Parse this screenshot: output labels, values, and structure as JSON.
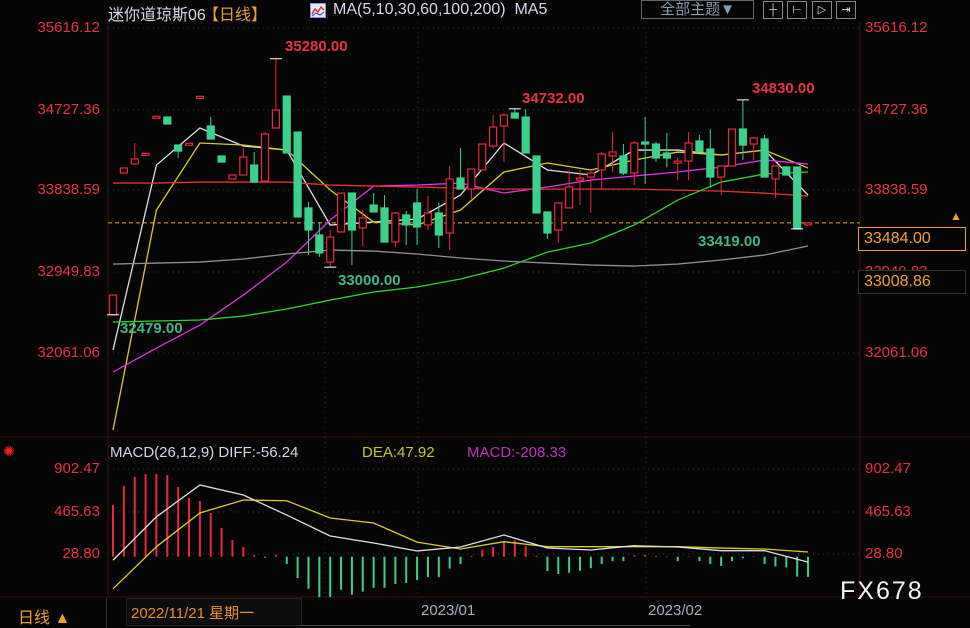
{
  "header": {
    "instrument": "迷你道琼斯06",
    "period": "【日线】",
    "indicator_legend": "MA(5,10,30,60,100,200)",
    "indicator_active": "MA5",
    "theme_button": "全部主题▼",
    "tools": [
      {
        "name": "crosshair-icon",
        "glyph": "┼"
      },
      {
        "name": "zoom-range-icon",
        "glyph": "⊢"
      },
      {
        "name": "play-range-icon",
        "glyph": "▷"
      },
      {
        "name": "shift-right-icon",
        "glyph": "⇥"
      }
    ]
  },
  "price_axis": [
    "35616.12",
    "34727.36",
    "33838.59",
    "32949.83",
    "32061.06"
  ],
  "price_boxes": {
    "current": "33484.00",
    "secondary": "33008.86"
  },
  "annotations": {
    "high1": "35280.00",
    "high2": "34732.00",
    "high3": "34830.00",
    "low1": "33000.00",
    "low0": "32479.00",
    "low2": "33419.00"
  },
  "macd": {
    "legend": "MACD(26,12,9)",
    "diff": "DIFF:-56.24",
    "dea": "DEA:47.92",
    "macd": "MACD:-208.33",
    "axis": [
      "902.47",
      "465.63",
      "28.80"
    ]
  },
  "bottom": {
    "period_button": "日线 ▲",
    "cursor_date": "2022/11/21 星期一",
    "x_labels": [
      "2023/01",
      "2023/02"
    ]
  },
  "watermark": "FX678",
  "colors": {
    "up": "#e8283c",
    "down": "#3cd08c",
    "ma5": "#e0e0e0",
    "ma10": "#d8d020",
    "ma30": "#e030e0",
    "ma60": "#e83030",
    "ma100": "#30d030",
    "ma200": "#909090",
    "current_line": "#f0a030"
  },
  "chart_data": {
    "type": "candlestick",
    "title": "迷你道琼斯06 日线",
    "ylim": [
      32061.06,
      35616.12
    ],
    "candles_ohlc": [
      [
        32479,
        32695,
        32479,
        32695
      ],
      [
        34030,
        34085,
        34030,
        34085
      ],
      [
        34128,
        34358,
        34128,
        34183
      ],
      [
        34230,
        34245,
        34230,
        34245
      ],
      [
        34635,
        34650,
        34635,
        34650
      ],
      [
        34642,
        34642,
        34566,
        34566
      ],
      [
        34336,
        34336,
        34194,
        34270
      ],
      [
        34340,
        34355,
        34340,
        34355
      ],
      [
        34854,
        34869,
        34854,
        34869
      ],
      [
        34544,
        34642,
        34402,
        34402
      ],
      [
        34216,
        34216,
        34150,
        34150
      ],
      [
        33964,
        34008,
        33964,
        34008
      ],
      [
        34008,
        34303,
        34008,
        34205
      ],
      [
        34117,
        34260,
        33931,
        33931
      ],
      [
        33942,
        34478,
        33942,
        34456
      ],
      [
        34522,
        35280,
        34522,
        34719
      ],
      [
        34872,
        34872,
        34249,
        34249
      ],
      [
        34478,
        34478,
        33549,
        33549
      ],
      [
        33648,
        33713,
        33133,
        33407
      ],
      [
        33352,
        33494,
        33111,
        33155
      ],
      [
        33056,
        33407,
        33000,
        33330
      ],
      [
        33385,
        33811,
        33385,
        33811
      ],
      [
        33811,
        33811,
        33024,
        33407
      ],
      [
        33429,
        33626,
        33231,
        33538
      ],
      [
        33680,
        33811,
        33604,
        33604
      ],
      [
        33648,
        33789,
        33275,
        33275
      ],
      [
        33275,
        33604,
        33220,
        33593
      ],
      [
        33571,
        33615,
        33242,
        33462
      ],
      [
        33702,
        33855,
        33242,
        33440
      ],
      [
        33462,
        33779,
        33407,
        33593
      ],
      [
        33593,
        33702,
        33210,
        33352
      ],
      [
        33374,
        34107,
        33190,
        33964
      ],
      [
        33975,
        34303,
        33855,
        33855
      ],
      [
        33855,
        34074,
        33735,
        34074
      ],
      [
        34063,
        34347,
        34063,
        34347
      ],
      [
        34325,
        34664,
        34300,
        34533
      ],
      [
        34544,
        34686,
        34150,
        34664
      ],
      [
        34686,
        34732,
        34631,
        34631
      ],
      [
        34642,
        34731,
        34249,
        34249
      ],
      [
        34216,
        34216,
        33593,
        33593
      ],
      [
        33604,
        33604,
        33308,
        33374
      ],
      [
        33407,
        33702,
        33264,
        33702
      ],
      [
        33648,
        34063,
        33648,
        33877
      ],
      [
        33953,
        34063,
        33680,
        33975
      ],
      [
        33986,
        34063,
        33593,
        34030
      ],
      [
        34063,
        34260,
        33855,
        34238
      ],
      [
        34216,
        34478,
        34041,
        34260
      ],
      [
        34216,
        34347,
        34008,
        34030
      ],
      [
        34030,
        34380,
        33900,
        34358
      ],
      [
        34369,
        34642,
        33910,
        34347
      ],
      [
        34347,
        34369,
        34150,
        34194
      ],
      [
        34249,
        34467,
        34090,
        34194
      ],
      [
        34140,
        34200,
        33950,
        34160
      ],
      [
        34161,
        34478,
        33950,
        34358
      ],
      [
        34380,
        34445,
        34260,
        34260
      ],
      [
        34292,
        34511,
        33870,
        33986
      ],
      [
        33986,
        34107,
        33790,
        34107
      ],
      [
        34107,
        34511,
        34107,
        34511
      ],
      [
        34511,
        34830,
        34172,
        34336
      ],
      [
        34347,
        34413,
        34172,
        34413
      ],
      [
        34402,
        34445,
        33986,
        33986
      ],
      [
        33964,
        34107,
        33760,
        34107
      ],
      [
        34096,
        34110,
        34008,
        34008
      ],
      [
        34096,
        34096,
        33419,
        33418
      ],
      [
        33470,
        33490,
        33470,
        33484
      ]
    ],
    "current_price": 33484,
    "ma_sample_step": 4,
    "ma_lines": [
      {
        "name": "MA5",
        "color_key": "ma5",
        "values": [
          32093,
          34117,
          34522,
          34325,
          34281,
          33461,
          33494,
          33526,
          33789,
          34358,
          34063,
          34008,
          34281,
          34281,
          34227,
          34281,
          33789
        ]
      },
      {
        "name": "MA10",
        "color_key": "ma10",
        "values": [
          31218,
          33625,
          34358,
          34336,
          34281,
          33844,
          33494,
          33461,
          33625,
          34041,
          34139,
          34063,
          34172,
          34259,
          34227,
          34281,
          34084
        ]
      },
      {
        "name": "MA30",
        "color_key": "ma30",
        "values": [
          31853,
          32115,
          32367,
          32695,
          33056,
          33516,
          33887,
          33898,
          33920,
          33811,
          33877,
          33953,
          33997,
          34041,
          34095,
          34172,
          34128
        ]
      },
      {
        "name": "MA60",
        "color_key": "ma60",
        "values": [
          33920,
          33920,
          33931,
          33931,
          33931,
          33898,
          33887,
          33876,
          33865,
          33854,
          33854,
          33854,
          33854,
          33843,
          33832,
          33810,
          33778
        ]
      },
      {
        "name": "MA100",
        "color_key": "ma100",
        "values": [
          32400,
          32411,
          32422,
          32465,
          32542,
          32640,
          32728,
          32783,
          32870,
          32990,
          33165,
          33264,
          33461,
          33734,
          33931,
          34019,
          34041
        ]
      },
      {
        "name": "MA200",
        "color_key": "ma200",
        "values": [
          33034,
          33045,
          33056,
          33089,
          33144,
          33187,
          33176,
          33144,
          33100,
          33067,
          33045,
          33023,
          33012,
          33034,
          33078,
          33133,
          33231
        ]
      }
    ],
    "macd_ylim": [
      -420,
      902.47
    ],
    "macd_hist": [
      531,
      727,
      819,
      850,
      850,
      840,
      716,
      603,
      572,
      449,
      295,
      172,
      100,
      17,
      -10,
      20,
      -75,
      -220,
      -330,
      -415,
      -415,
      -340,
      -390,
      -360,
      -320,
      -320,
      -280,
      -270,
      -240,
      -210,
      -210,
      -122,
      -75,
      10,
      70,
      100,
      155,
      170,
      110,
      10,
      -147,
      -178,
      -165,
      -145,
      -118,
      -75,
      -45,
      -45,
      15,
      20,
      10,
      5,
      -45,
      5,
      -45,
      -75,
      -95,
      -45,
      -15,
      5,
      -75,
      -100,
      -110,
      -205,
      -208
    ],
    "diff_values": [
      -35,
      410,
      737,
      634,
      428,
      213,
      141,
      59,
      100,
      223,
      89,
      69,
      113,
      100,
      62,
      62,
      -56
    ],
    "dea_values": [
      -330,
      103,
      449,
      583,
      575,
      398,
      346,
      150,
      79,
      154,
      103,
      103,
      103,
      103,
      89,
      79,
      48
    ]
  }
}
